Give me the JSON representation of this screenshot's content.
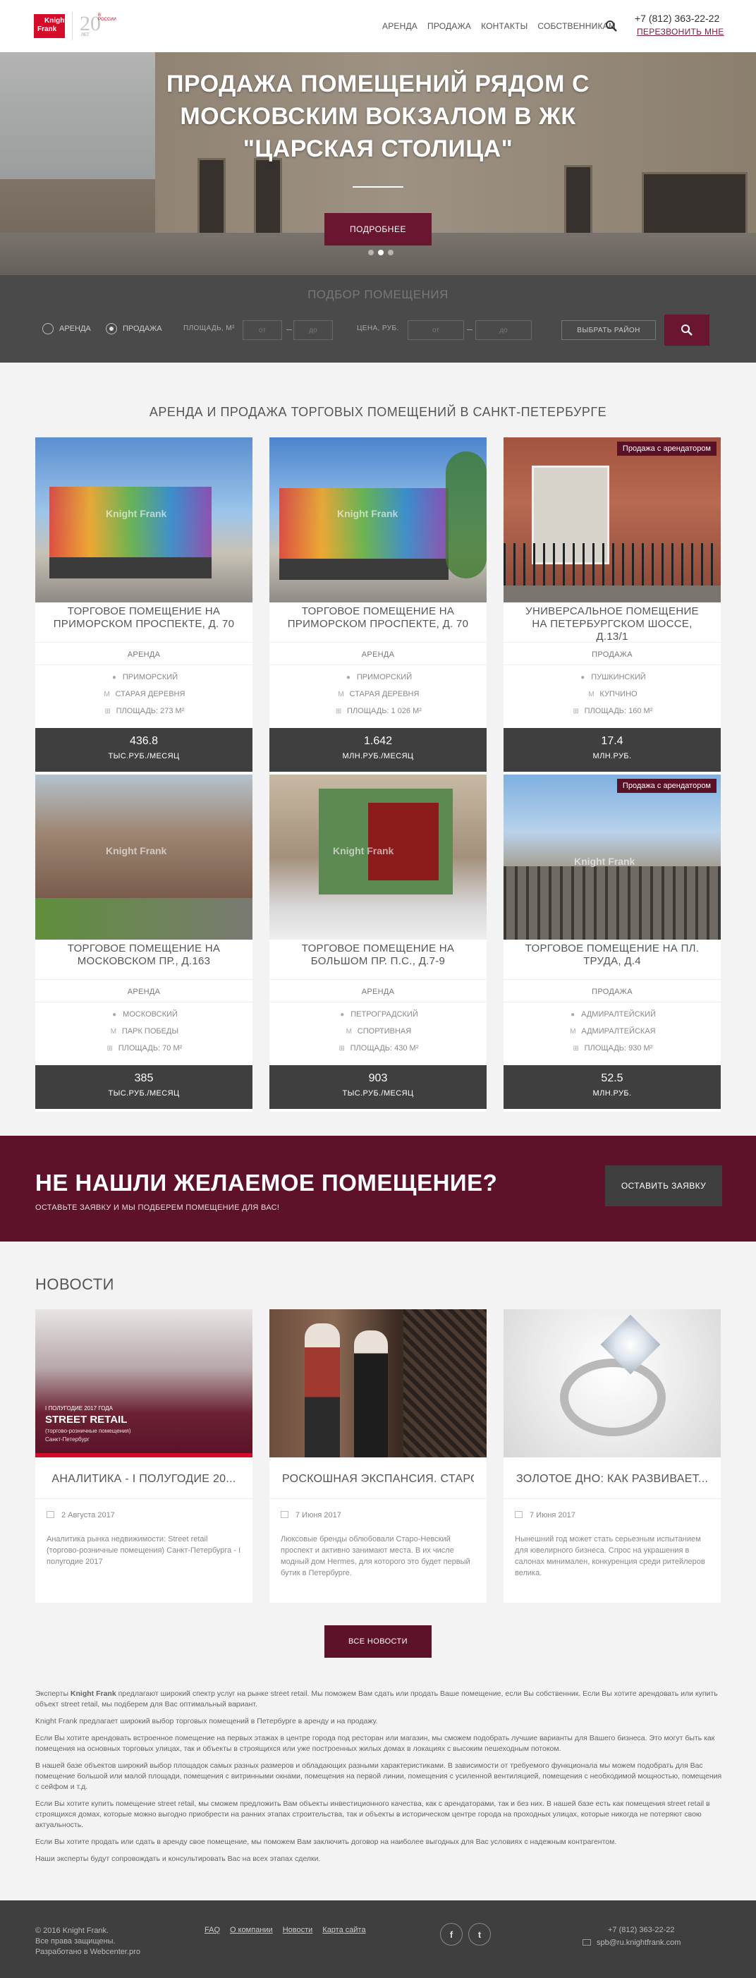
{
  "header": {
    "logo_line1": "Knight",
    "logo_line2": "Frank",
    "anniversary_label": "В РОССИИ",
    "anniversary_number": "20",
    "anniversary_sub": "ЛЕТ",
    "nav": [
      "АРЕНДА",
      "ПРОДАЖА",
      "КОНТАКТЫ",
      "СОБСТВЕННИКАМ"
    ],
    "phone": "+7 (812) 363-22-22",
    "callback": "ПЕРЕЗВОНИТЬ МНЕ"
  },
  "hero": {
    "title": "ПРОДАЖА ПОМЕЩЕНИЙ РЯДОМ С МОСКОВСКИМ ВОКЗАЛОМ В ЖК \"ЦАРСКАЯ СТОЛИЦА\"",
    "button": "ПОДРОБНЕЕ",
    "slides": 3,
    "active_slide": 2
  },
  "filter": {
    "title": "ПОДБОР ПОМЕЩЕНИЯ",
    "radio_rent": "АРЕНДА",
    "radio_sale": "ПРОДАЖА",
    "selected": "ПРОДАЖА",
    "area_label": "ПЛОЩАДЬ, М²",
    "price_label": "ЦЕНА, РУБ.",
    "from_placeholder": "от",
    "to_placeholder": "до",
    "district_button": "ВЫБРАТЬ РАЙОН"
  },
  "listings": {
    "title": "АРЕНДА И ПРОДАЖА ТОРГОВЫХ ПОМЕЩЕНИЙ В САНКТ-ПЕТЕРБУРГЕ",
    "items": [
      {
        "title": "ТОРГОВОЕ ПОМЕЩЕНИЕ НА ПРИМОРСКОМ ПРОСПЕКТЕ, Д. 70",
        "deal": "АРЕНДА",
        "district": "ПРИМОРСКИЙ",
        "metro": "СТАРАЯ ДЕРЕВНЯ",
        "area": "ПЛОЩАДЬ: 273 М²",
        "price": "436.8",
        "unit": "ТЫС.РУБ./МЕСЯЦ",
        "tag": ""
      },
      {
        "title": "ТОРГОВОЕ ПОМЕЩЕНИЕ НА ПРИМОРСКОМ ПРОСПЕКТЕ, Д. 70",
        "deal": "АРЕНДА",
        "district": "ПРИМОРСКИЙ",
        "metro": "СТАРАЯ ДЕРЕВНЯ",
        "area": "ПЛОЩАДЬ: 1 026 М²",
        "price": "1.642",
        "unit": "МЛН.РУБ./МЕСЯЦ",
        "tag": ""
      },
      {
        "title": "УНИВЕРСАЛЬНОЕ ПОМЕЩЕНИЕ НА ПЕТЕРБУРГСКОМ ШОССЕ, Д.13/1",
        "deal": "ПРОДАЖА",
        "district": "ПУШКИНСКИЙ",
        "metro": "КУПЧИНО",
        "area": "ПЛОЩАДЬ: 160 М²",
        "price": "17.4",
        "unit": "МЛН.РУБ.",
        "tag": "Продажа с арендатором"
      },
      {
        "title": "ТОРГОВОЕ ПОМЕЩЕНИЕ НА МОСКОВСКОМ ПР., Д.163",
        "deal": "АРЕНДА",
        "district": "МОСКОВСКИЙ",
        "metro": "ПАРК ПОБЕДЫ",
        "area": "ПЛОЩАДЬ: 70 М²",
        "price": "385",
        "unit": "ТЫС.РУБ./МЕСЯЦ",
        "tag": ""
      },
      {
        "title": "ТОРГОВОЕ ПОМЕЩЕНИЕ НА БОЛЬШОМ ПР. П.С., Д.7-9",
        "deal": "АРЕНДА",
        "district": "ПЕТРОГРАДСКИЙ",
        "metro": "СПОРТИВНАЯ",
        "area": "ПЛОЩАДЬ: 430 М²",
        "price": "903",
        "unit": "ТЫС.РУБ./МЕСЯЦ",
        "tag": ""
      },
      {
        "title": "ТОРГОВОЕ ПОМЕЩЕНИЕ НА ПЛ. ТРУДА, Д.4",
        "deal": "ПРОДАЖА",
        "district": "АДМИРАЛТЕЙСКИЙ",
        "metro": "АДМИРАЛТЕЙСКАЯ",
        "area": "ПЛОЩАДЬ: 930 М²",
        "price": "52.5",
        "unit": "МЛН.РУБ.",
        "tag": "Продажа с арендатором"
      }
    ],
    "watermark": "Knight Frank"
  },
  "banner": {
    "title": "НЕ НАШЛИ ЖЕЛАЕМОЕ ПОМЕЩЕНИЕ?",
    "subtitle": "ОСТАВЬТЕ ЗАЯВКУ И МЫ ПОДБЕРЕМ ПОМЕЩЕНИЕ ДЛЯ ВАС!",
    "button": "ОСТАВИТЬ ЗАЯВКУ"
  },
  "news": {
    "title": "НОВОСТИ",
    "items": [
      {
        "title": "АНАЛИТИКА - I ПОЛУГОДИЕ 20...",
        "date": "2 Августа 2017",
        "text": "Аналитика рынка недвижимости: Street retail (торгово-розничные помещения) Санкт-Петербурга - I полугодие 2017",
        "img_caption_1": "I ПОЛУГОДИЕ 2017 ГОДА",
        "img_caption_2": "STREET RETAIL",
        "img_caption_3": "(торгово-розничные помещения)",
        "img_caption_4": "Санкт-Петербург"
      },
      {
        "title": "РОСКОШНАЯ ЭКСПАНСИЯ. СТАРО...",
        "date": "7 Июня 2017",
        "text": "Люксовые бренды облюбовали Старо-Невский проспект и активно занимают места. В их числе модный дом Hermes, для которого это будет первый бутик в Петербурге."
      },
      {
        "title": "ЗОЛОТОЕ ДНО: КАК РАЗВИВАЕТ...",
        "date": "7 Июня 2017",
        "text": "Нынешний год может стать серьезным испытанием для ювелирного бизнеса. Спрос на украшения в салонах минимален, конкуренция среди ритейлеров велика."
      }
    ],
    "all_button": "ВСЕ НОВОСТИ"
  },
  "seo": {
    "p1_prefix": "Эксперты ",
    "p1_brand": "Knight Frank",
    "p1_rest": " предлагают широкий спектр услуг на рынке street retail. Мы поможем Вам сдать или продать Ваше помещение, если Вы собственник. Если Вы хотите арендовать или купить объект street retail, мы подберем для Вас оптимальный вариант.",
    "p2": "Knight Frank предлагает широкий выбор торговых помещений в Петербурге в аренду и на продажу.",
    "p3": "Если Вы хотите арендовать встроенное помещение на первых этажах в центре города под ресторан или магазин, мы сможем подобрать лучшие варианты для Вашего бизнеса. Это могут быть как помещения на основных торговых улицах, так и объекты в строящихся или уже построенных жилых домах в локациях с высоким пешеходным потоком.",
    "p4": "В нашей базе объектов широкий выбор площадок самых разных размеров и обладающих разными характеристиками. В зависимости от требуемого функционала мы можем подобрать для Вас помещение большой или малой площади, помещения с витринными окнами, помещения на первой линии, помещения с усиленной вентиляцией, помещения с необходимой мощностью, помещения с сейфом и т.д.",
    "p5": "Если Вы хотите купить помещение street retail, мы сможем предложить Вам объекты инвестиционного качества, как с арендаторами, так и без них. В нашей базе есть как помещения street retail в строящихся домах, которые можно выгодно приобрести на ранних этапах строительства, так и объекты в историческом центре города на проходных улицах, которые никогда не потеряют свою актуальность.",
    "p6": "Если Вы хотите продать или сдать в аренду свое помещение, мы поможем Вам заключить договор на наиболее выгодных для Вас условиях с надежным контрагентом.",
    "p7": "Наши эксперты будут сопровождать и консультировать Вас на всех этапах сделки."
  },
  "footer": {
    "copyright": "© 2016 Knight Frank.",
    "rights": "Все права защищены.",
    "dev": "Разработано в Webcenter.pro",
    "links": [
      "FAQ",
      "О компании",
      "Новости",
      "Карта сайта"
    ],
    "facebook": "f",
    "twitter": "t",
    "phone": "+7 (812) 363-22-22",
    "email": "spb@ru.knightfrank.com"
  },
  "colors": {
    "brand_red": "#d40c2a",
    "accent_burgundy": "#6b1630",
    "dark_panel": "#3f3f3f"
  }
}
